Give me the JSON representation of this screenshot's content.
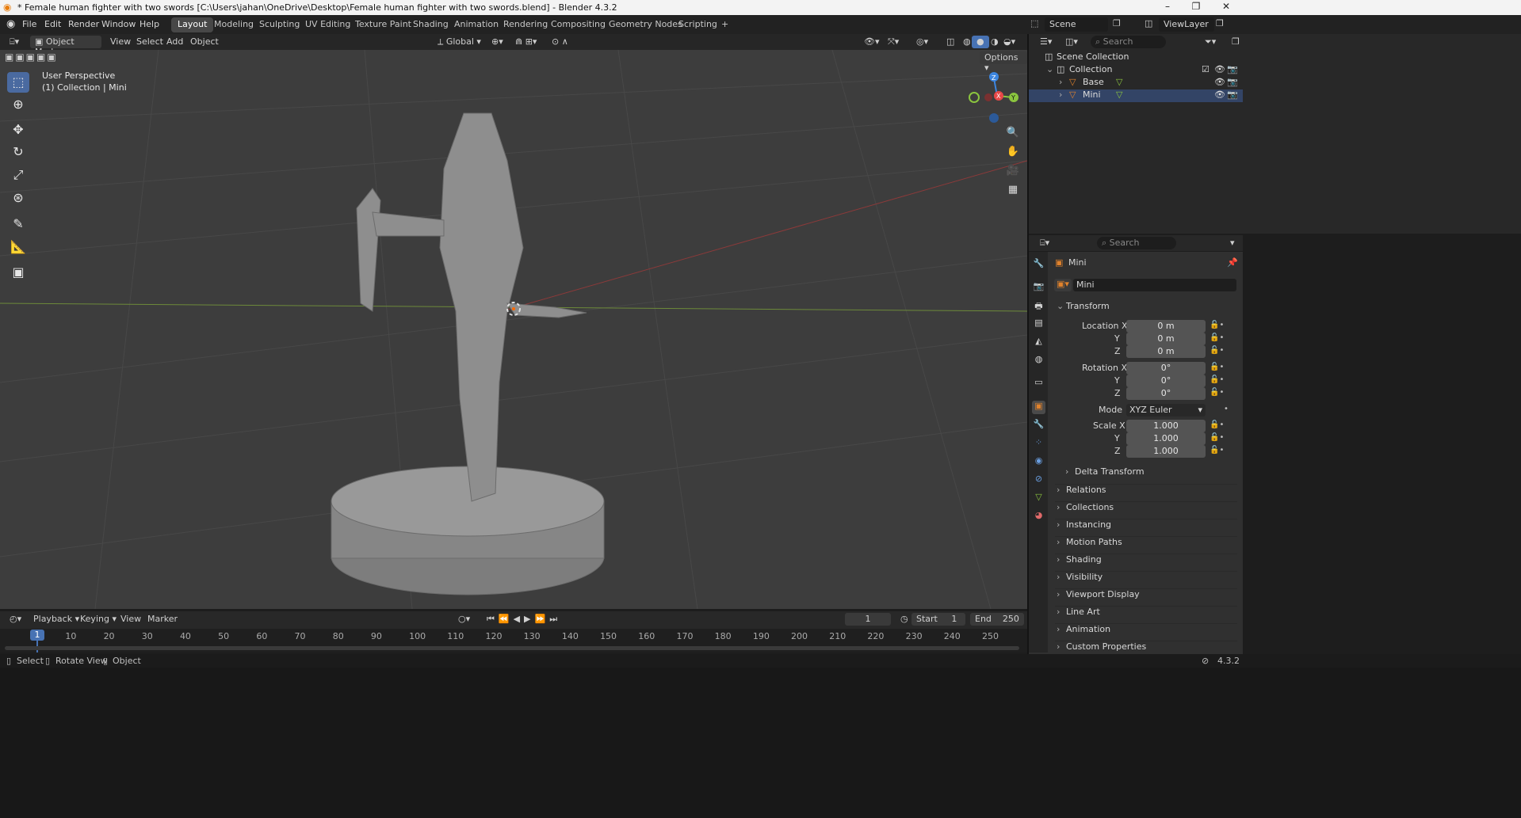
{
  "titlebar": {
    "title": "* Female human fighter with two swords [C:\\Users\\jahan\\OneDrive\\Desktop\\Female human fighter with two swords.blend] - Blender 4.3.2",
    "minimize": "–",
    "maximize": "❐",
    "close": "✕"
  },
  "menu": [
    "File",
    "Edit",
    "Render",
    "Window",
    "Help"
  ],
  "workspace_tabs": [
    "Layout",
    "Modeling",
    "Sculpting",
    "UV Editing",
    "Texture Paint",
    "Shading",
    "Animation",
    "Rendering",
    "Compositing",
    "Geometry Nodes",
    "Scripting",
    "+"
  ],
  "scene": {
    "scene_label": "Scene",
    "viewlayer_label": "ViewLayer"
  },
  "viewport_header": {
    "mode": "Object Mode",
    "menus": [
      "View",
      "Select",
      "Add",
      "Object"
    ],
    "orientation": "Global",
    "options": "Options"
  },
  "viewport": {
    "perspective": "User Perspective",
    "collection": "(1) Collection | Mini",
    "gizmo": {
      "x": "X",
      "y": "Y",
      "z": "Z"
    }
  },
  "outliner": {
    "search_placeholder": "Search",
    "scene_collection": "Scene Collection",
    "collection": "Collection",
    "items": [
      "Base",
      "Mini"
    ]
  },
  "properties": {
    "search_placeholder": "Search",
    "object_name": "Mini",
    "object_field": "Mini",
    "transform": "Transform",
    "location_x_label": "Location X",
    "rotation_x_label": "Rotation X",
    "scale_x_label": "Scale X",
    "y_label": "Y",
    "z_label": "Z",
    "mode_label": "Mode",
    "location": [
      "0 m",
      "0 m",
      "0 m"
    ],
    "rotation": [
      "0°",
      "0°",
      "0°"
    ],
    "rotation_mode": "XYZ Euler",
    "scale": [
      "1.000",
      "1.000",
      "1.000"
    ],
    "delta_transform": "Delta Transform",
    "sections": [
      "Relations",
      "Collections",
      "Instancing",
      "Motion Paths",
      "Shading",
      "Visibility",
      "Viewport Display",
      "Line Art",
      "Animation",
      "Custom Properties"
    ]
  },
  "timeline": {
    "menus": [
      "Playback",
      "Keying",
      "View",
      "Marker"
    ],
    "current_frame": "1",
    "start_label": "Start",
    "start": "1",
    "end_label": "End",
    "end": "250",
    "ticks": [
      "10",
      "20",
      "30",
      "40",
      "50",
      "60",
      "70",
      "80",
      "90",
      "100",
      "110",
      "120",
      "130",
      "140",
      "150",
      "160",
      "170",
      "180",
      "190",
      "200",
      "210",
      "220",
      "230",
      "240",
      "250"
    ],
    "playhead": "1"
  },
  "statusbar": {
    "select": "Select",
    "rotate": "Rotate View",
    "object": "Object",
    "version": "4.3.2"
  },
  "colors": {
    "accent": "#4772b3",
    "active_tool": "#4a6aa0",
    "x_axis": "#e84848",
    "y_axis": "#8bc53f",
    "z_axis": "#3d86e0",
    "object_orange": "#e0822c"
  }
}
